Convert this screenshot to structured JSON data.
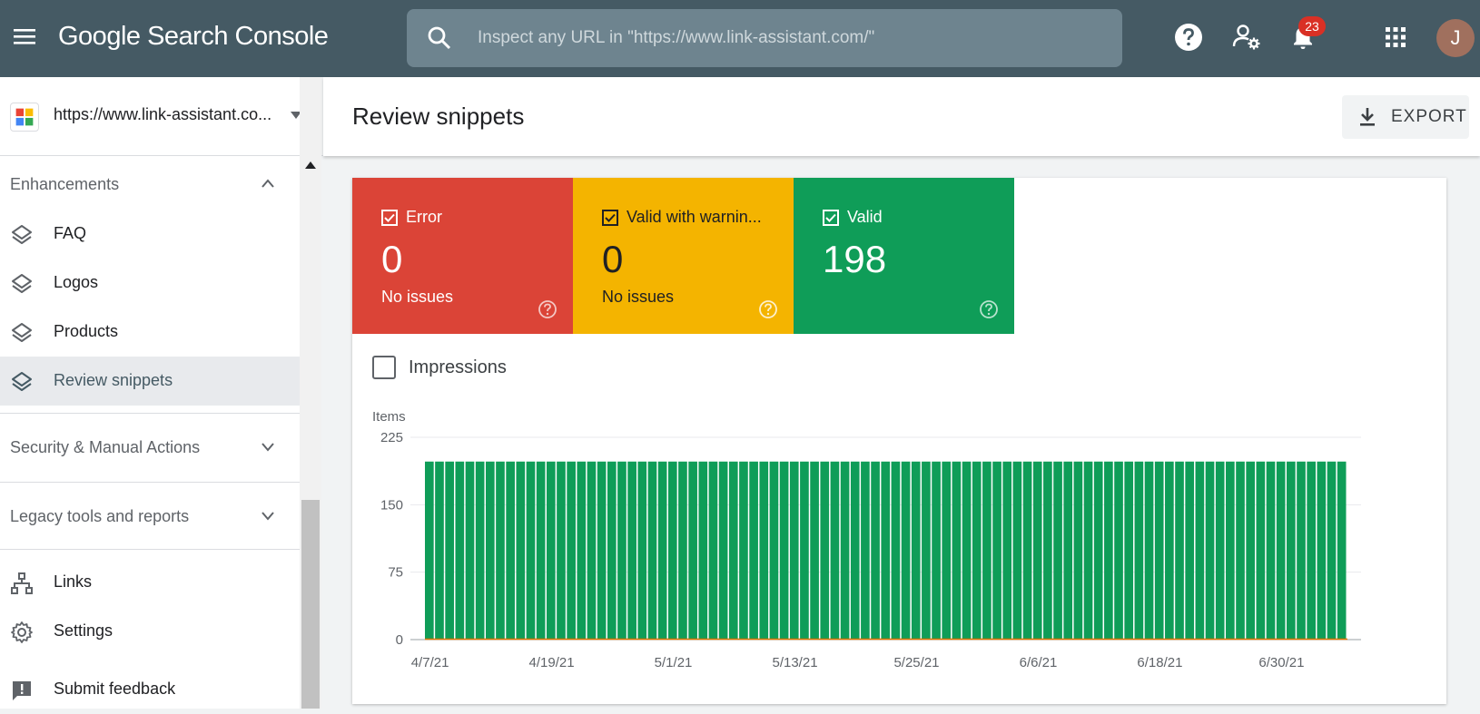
{
  "app": {
    "logo_text": "Google Search Console",
    "search_placeholder": "Inspect any URL in \"https://www.link-assistant.com/\"",
    "notification_count": "23",
    "avatar_initial": "J"
  },
  "sidebar": {
    "property_url": "https://www.link-assistant.co...",
    "enhancements_label": "Enhancements",
    "items": [
      {
        "label": "FAQ"
      },
      {
        "label": "Logos"
      },
      {
        "label": "Products"
      },
      {
        "label": "Review snippets"
      }
    ],
    "security_label": "Security & Manual Actions",
    "legacy_label": "Legacy tools and reports",
    "links_label": "Links",
    "settings_label": "Settings",
    "feedback_label": "Submit feedback"
  },
  "header": {
    "title": "Review snippets",
    "export_label": "EXPORT"
  },
  "tiles": [
    {
      "label": "Error",
      "count": "0",
      "sub": "No issues",
      "color": "#db4437",
      "text_color": "#ffffff"
    },
    {
      "label": "Valid with warnin...",
      "count": "0",
      "sub": "No issues",
      "color": "#f4b400",
      "text_color": "#202124"
    },
    {
      "label": "Valid",
      "count": "198",
      "sub": "",
      "color": "#0f9d58",
      "text_color": "#ffffff"
    }
  ],
  "impressions_label": "Impressions",
  "chart_data": {
    "type": "bar",
    "ylabel": "Items",
    "ylim": [
      0,
      225
    ],
    "yticks": [
      0,
      75,
      150,
      225
    ],
    "xtick_labels": [
      "4/7/21",
      "4/19/21",
      "5/1/21",
      "5/13/21",
      "5/25/21",
      "6/6/21",
      "6/18/21",
      "6/30/21"
    ],
    "xtick_indices": [
      0,
      12,
      24,
      36,
      48,
      60,
      72,
      84
    ],
    "num_bars": 91,
    "series": [
      {
        "name": "Valid",
        "color": "#0f9d58",
        "value": 198
      },
      {
        "name": "Valid with warnings",
        "color": "#f4b400",
        "value": 0
      },
      {
        "name": "Error",
        "color": "#db4437",
        "value": 0
      }
    ],
    "grid": true
  }
}
